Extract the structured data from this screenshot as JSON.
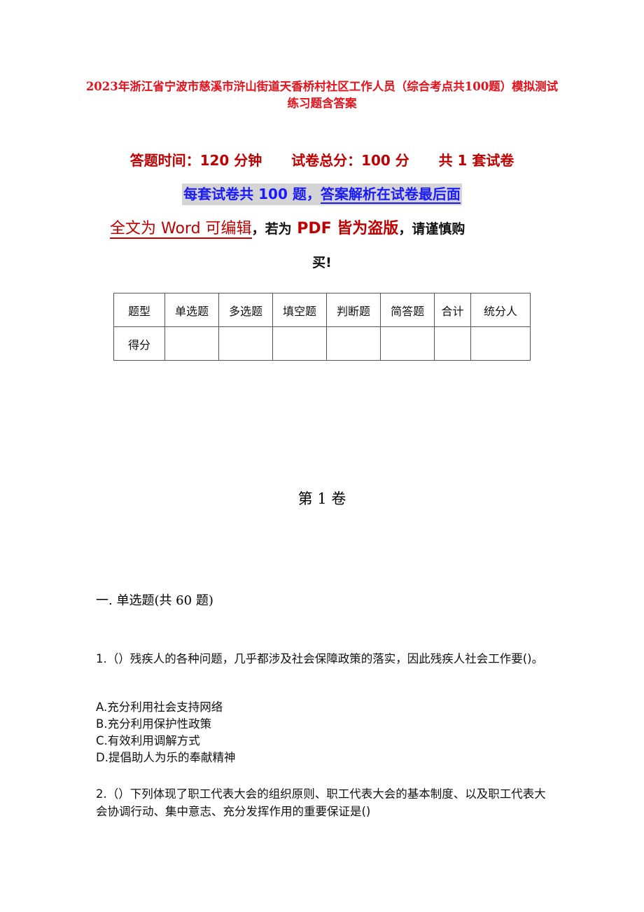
{
  "document": {
    "title": "2023年浙江省宁波市慈溪市浒山街道天香桥村社区工作人员（综合考点共100题）模拟测试练习题含答案",
    "info_line": {
      "time": "答题时间：120 分钟",
      "total_score": "试卷总分：100 分",
      "sets": "共 1 套试卷"
    },
    "banner": {
      "part1": "每套试卷共 100 题，",
      "part2": "答案解析在试卷最后面"
    },
    "notice": {
      "part1": "全文为 Word 可编辑",
      "sep1": "，",
      "part2": "若为",
      "part3": " PDF 皆为盗版",
      "sep2": "，",
      "part4": "请谨慎购",
      "part5": "买!"
    },
    "score_table": {
      "header": [
        "题型",
        "单选题",
        "多选题",
        "填空题",
        "判断题",
        "简答题",
        "合计",
        "统分人"
      ],
      "row": [
        "得分",
        "",
        "",
        "",
        "",
        "",
        "",
        ""
      ]
    },
    "volume_title": "第 1 卷",
    "section_title": "一. 单选题(共 60 题)",
    "questions": [
      {
        "text": "1.（）残疾人的各种问题，几乎都涉及社会保障政策的落实，因此残疾人社会工作要()。",
        "options": [
          "A.充分利用社会支持网络",
          "B.充分利用保护性政策",
          "C.有效利用调解方式",
          "D.提倡助人为乐的奉献精神"
        ]
      },
      {
        "text": "2.（）下列体现了职工代表大会的组织原则、职工代表大会的基本制度、以及职工代表大会协调行动、集中意志、充分发挥作用的重要保证是()"
      }
    ]
  }
}
